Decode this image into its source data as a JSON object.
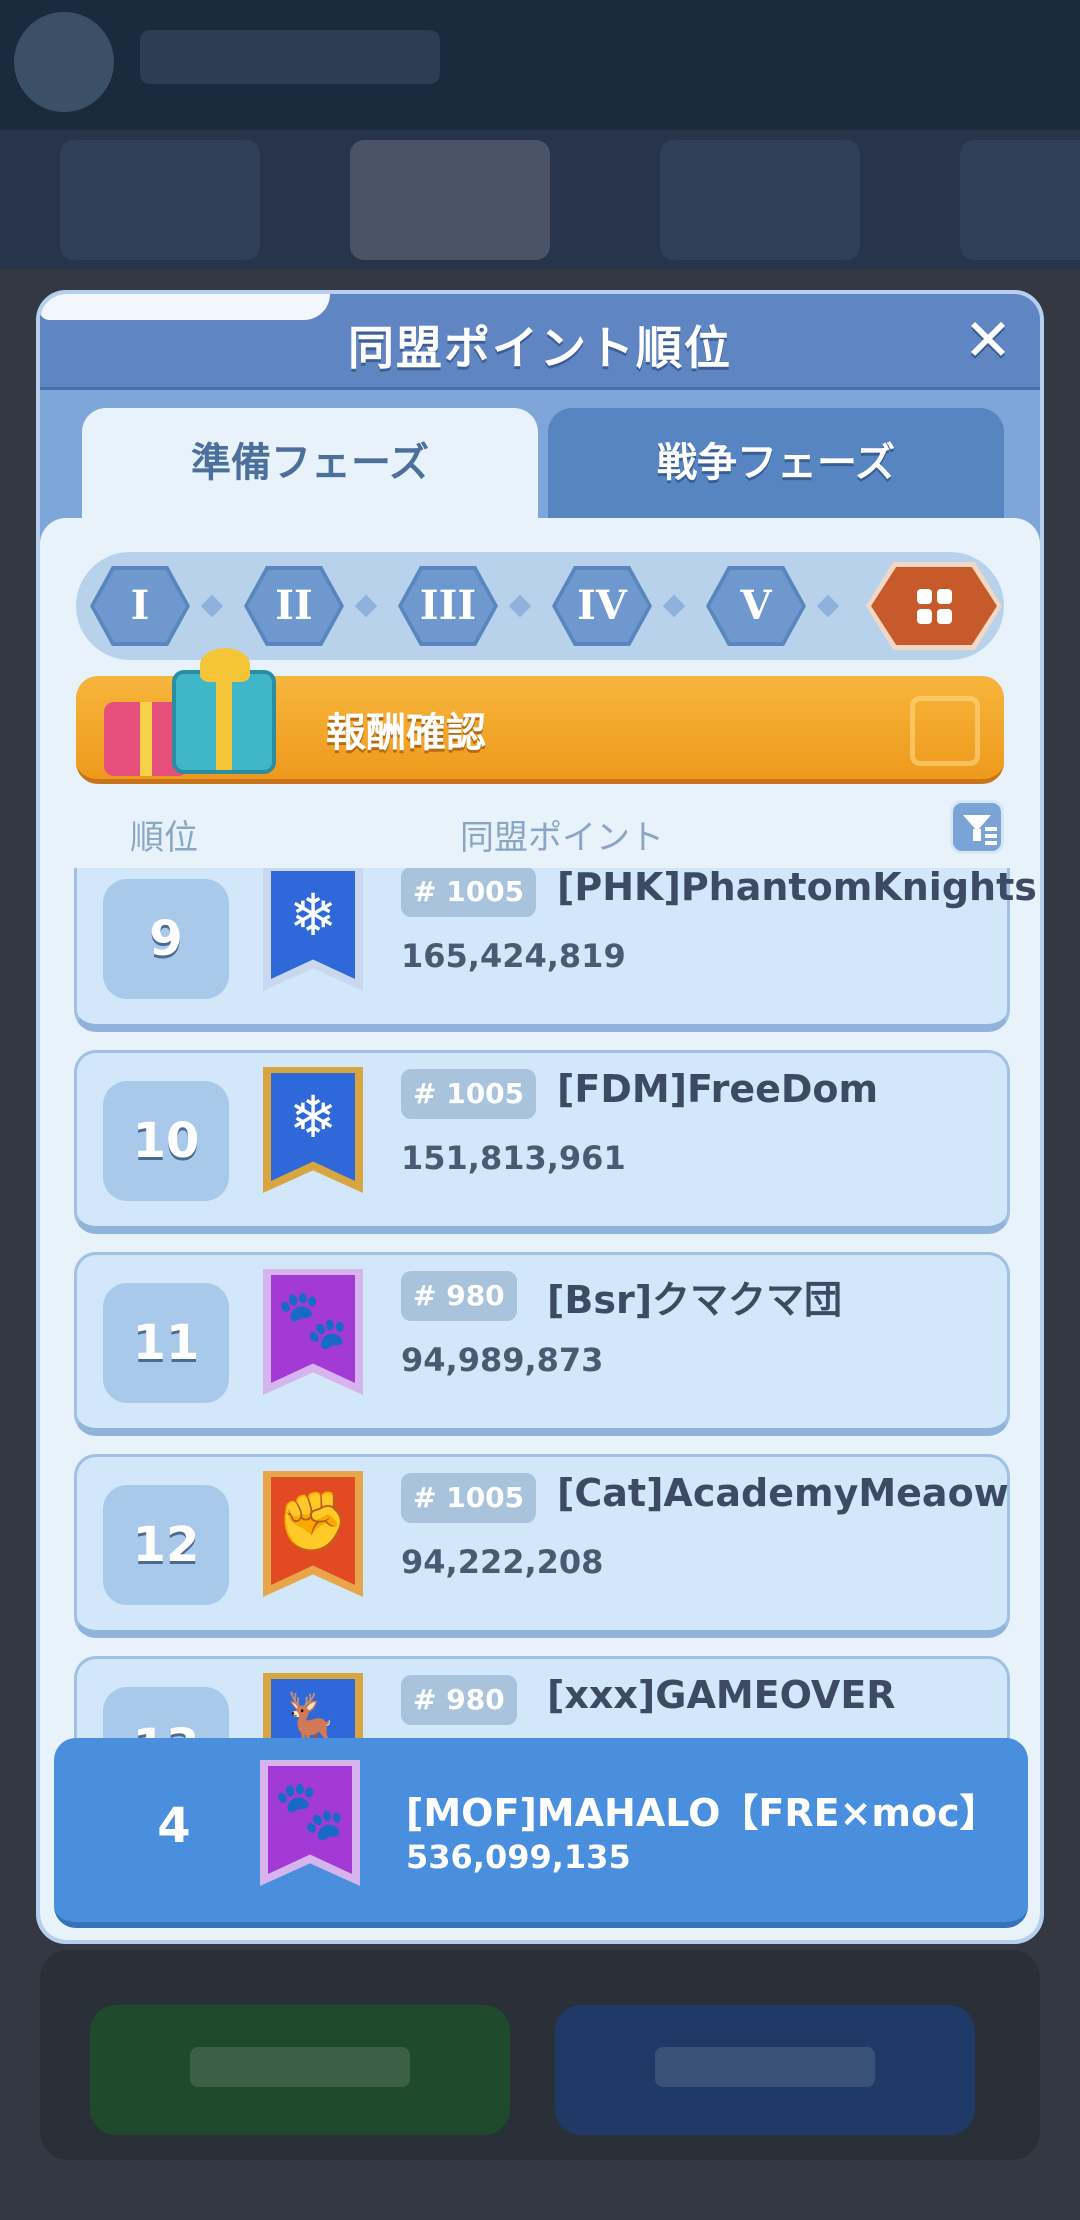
{
  "modal": {
    "title": "同盟ポイント順位",
    "close_glyph": "✕"
  },
  "tabs": [
    {
      "label": "準備フェーズ",
      "active": true
    },
    {
      "label": "戦争フェーズ",
      "active": false
    }
  ],
  "levels": [
    "I",
    "II",
    "III",
    "IV",
    "V"
  ],
  "levels_selected": "all-grid-icon",
  "reward_banner": {
    "label": "報酬確認"
  },
  "list_header": {
    "rank": "順位",
    "points": "同盟ポイント"
  },
  "rows": [
    {
      "rank": "9",
      "server": "# 1005",
      "name": "[PHK]PhantomKnights",
      "points": "165,424,819",
      "emblem": "snowflake-icon",
      "color": "#2f68d8"
    },
    {
      "rank": "10",
      "server": "# 1005",
      "name": "[FDM]FreeDom",
      "points": "151,813,961",
      "emblem": "snowflake-icon",
      "color": "#2f68d8"
    },
    {
      "rank": "11",
      "server": "# 980",
      "name": "[Bsr]クマクマ団",
      "points": "94,989,873",
      "emblem": "paw-icon",
      "color": "#a43ad6"
    },
    {
      "rank": "12",
      "server": "# 1005",
      "name": "[Cat]AcademyMeaow",
      "points": "94,222,208",
      "emblem": "fist-icon",
      "color": "#e24a22"
    },
    {
      "rank": "13",
      "server": "# 980",
      "name": "[xxx]GAMEOVER",
      "points": "",
      "emblem": "moose-icon",
      "color": "#2f68d8"
    }
  ],
  "my_rank": {
    "rank": "4",
    "name": "[MOF]MAHALO【FRE×moc】",
    "points": "536,099,135",
    "emblem": "paw-icon",
    "color": "#a43ad6"
  }
}
